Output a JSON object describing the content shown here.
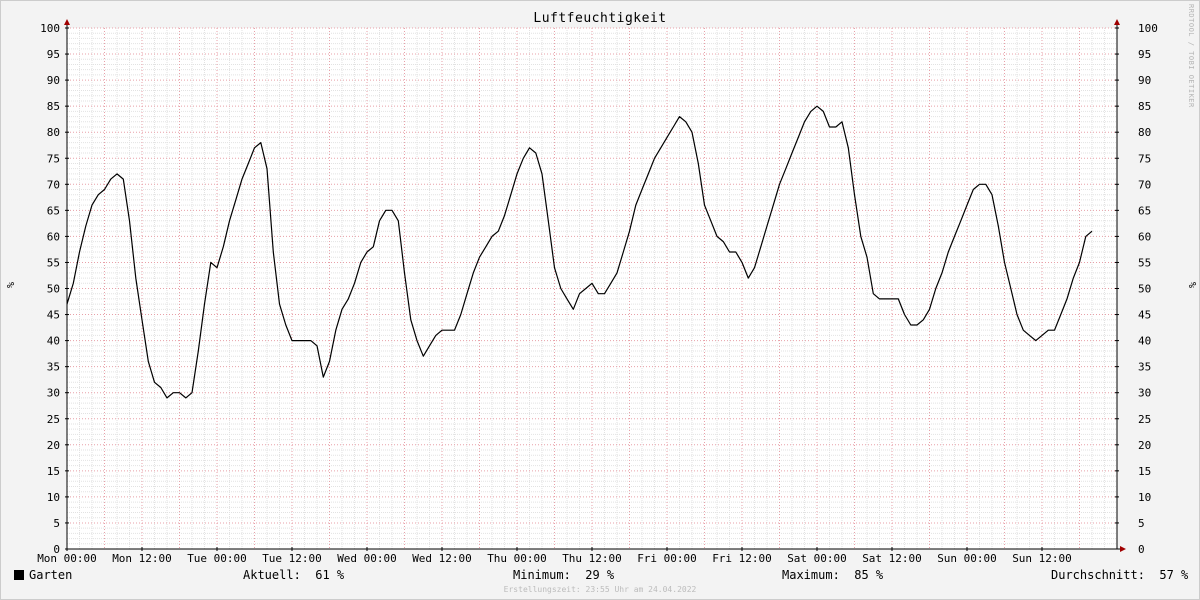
{
  "chart_data": {
    "type": "line",
    "title": "Luftfeuchtigkeit",
    "ylabel": "%",
    "ylim": [
      0,
      100
    ],
    "yticks": [
      0,
      5,
      10,
      15,
      20,
      25,
      30,
      35,
      40,
      45,
      50,
      55,
      60,
      65,
      70,
      75,
      80,
      85,
      90,
      95,
      100
    ],
    "x_tick_labels": [
      "Mon 00:00",
      "Mon 12:00",
      "Tue 00:00",
      "Tue 12:00",
      "Wed 00:00",
      "Wed 12:00",
      "Thu 00:00",
      "Thu 12:00",
      "Fri 00:00",
      "Fri 12:00",
      "Sat 00:00",
      "Sat 12:00",
      "Sun 00:00",
      "Sun 12:00"
    ],
    "x_unit": "hours since Mon 00:00",
    "xlim": [
      0,
      168
    ],
    "grid": true,
    "legend_position": "bottom-left",
    "series": [
      {
        "name": "Garten",
        "color": "#000000",
        "points": [
          [
            0,
            47
          ],
          [
            1,
            51
          ],
          [
            2,
            57
          ],
          [
            3,
            62
          ],
          [
            4,
            66
          ],
          [
            5,
            68
          ],
          [
            6,
            69
          ],
          [
            7,
            71
          ],
          [
            8,
            72
          ],
          [
            9,
            71
          ],
          [
            10,
            63
          ],
          [
            11,
            52
          ],
          [
            12,
            44
          ],
          [
            13,
            36
          ],
          [
            14,
            32
          ],
          [
            15,
            31
          ],
          [
            16,
            29
          ],
          [
            17,
            30
          ],
          [
            18,
            30
          ],
          [
            19,
            29
          ],
          [
            20,
            30
          ],
          [
            21,
            38
          ],
          [
            22,
            47
          ],
          [
            23,
            55
          ],
          [
            24,
            54
          ],
          [
            25,
            58
          ],
          [
            26,
            63
          ],
          [
            27,
            67
          ],
          [
            28,
            71
          ],
          [
            29,
            74
          ],
          [
            30,
            77
          ],
          [
            31,
            78
          ],
          [
            32,
            73
          ],
          [
            33,
            57
          ],
          [
            34,
            47
          ],
          [
            35,
            43
          ],
          [
            36,
            40
          ],
          [
            37,
            40
          ],
          [
            38,
            40
          ],
          [
            39,
            40
          ],
          [
            40,
            39
          ],
          [
            41,
            33
          ],
          [
            42,
            36
          ],
          [
            43,
            42
          ],
          [
            44,
            46
          ],
          [
            45,
            48
          ],
          [
            46,
            51
          ],
          [
            47,
            55
          ],
          [
            48,
            57
          ],
          [
            49,
            58
          ],
          [
            50,
            63
          ],
          [
            51,
            65
          ],
          [
            52,
            65
          ],
          [
            53,
            63
          ],
          [
            54,
            53
          ],
          [
            55,
            44
          ],
          [
            56,
            40
          ],
          [
            57,
            37
          ],
          [
            58,
            39
          ],
          [
            59,
            41
          ],
          [
            60,
            42
          ],
          [
            61,
            42
          ],
          [
            62,
            42
          ],
          [
            63,
            45
          ],
          [
            64,
            49
          ],
          [
            65,
            53
          ],
          [
            66,
            56
          ],
          [
            67,
            58
          ],
          [
            68,
            60
          ],
          [
            69,
            61
          ],
          [
            70,
            64
          ],
          [
            71,
            68
          ],
          [
            72,
            72
          ],
          [
            73,
            75
          ],
          [
            74,
            77
          ],
          [
            75,
            76
          ],
          [
            76,
            72
          ],
          [
            77,
            63
          ],
          [
            78,
            54
          ],
          [
            79,
            50
          ],
          [
            80,
            48
          ],
          [
            81,
            46
          ],
          [
            82,
            49
          ],
          [
            83,
            50
          ],
          [
            84,
            51
          ],
          [
            85,
            49
          ],
          [
            86,
            49
          ],
          [
            87,
            51
          ],
          [
            88,
            53
          ],
          [
            89,
            57
          ],
          [
            90,
            61
          ],
          [
            91,
            66
          ],
          [
            92,
            69
          ],
          [
            93,
            72
          ],
          [
            94,
            75
          ],
          [
            95,
            77
          ],
          [
            96,
            79
          ],
          [
            97,
            81
          ],
          [
            98,
            83
          ],
          [
            99,
            82
          ],
          [
            100,
            80
          ],
          [
            101,
            74
          ],
          [
            102,
            66
          ],
          [
            103,
            63
          ],
          [
            104,
            60
          ],
          [
            105,
            59
          ],
          [
            106,
            57
          ],
          [
            107,
            57
          ],
          [
            108,
            55
          ],
          [
            109,
            52
          ],
          [
            110,
            54
          ],
          [
            111,
            58
          ],
          [
            112,
            62
          ],
          [
            113,
            66
          ],
          [
            114,
            70
          ],
          [
            115,
            73
          ],
          [
            116,
            76
          ],
          [
            117,
            79
          ],
          [
            118,
            82
          ],
          [
            119,
            84
          ],
          [
            120,
            85
          ],
          [
            121,
            84
          ],
          [
            122,
            81
          ],
          [
            123,
            81
          ],
          [
            124,
            82
          ],
          [
            125,
            77
          ],
          [
            126,
            68
          ],
          [
            127,
            60
          ],
          [
            128,
            56
          ],
          [
            129,
            49
          ],
          [
            130,
            48
          ],
          [
            131,
            48
          ],
          [
            132,
            48
          ],
          [
            133,
            48
          ],
          [
            134,
            45
          ],
          [
            135,
            43
          ],
          [
            136,
            43
          ],
          [
            137,
            44
          ],
          [
            138,
            46
          ],
          [
            139,
            50
          ],
          [
            140,
            53
          ],
          [
            141,
            57
          ],
          [
            142,
            60
          ],
          [
            143,
            63
          ],
          [
            144,
            66
          ],
          [
            145,
            69
          ],
          [
            146,
            70
          ],
          [
            147,
            70
          ],
          [
            148,
            68
          ],
          [
            149,
            62
          ],
          [
            150,
            55
          ],
          [
            151,
            50
          ],
          [
            152,
            45
          ],
          [
            153,
            42
          ],
          [
            154,
            41
          ],
          [
            155,
            40
          ],
          [
            156,
            41
          ],
          [
            157,
            42
          ],
          [
            158,
            42
          ],
          [
            159,
            45
          ],
          [
            160,
            48
          ],
          [
            161,
            52
          ],
          [
            162,
            55
          ],
          [
            163,
            60
          ],
          [
            164,
            61
          ]
        ]
      }
    ]
  },
  "watermark": "RRDTOOL / TOBI OETIKER",
  "legend": {
    "series_name": "Garten",
    "current_label": "Aktuell:",
    "current_value": "61 %",
    "min_label": "Minimum:",
    "min_value": "29 %",
    "max_label": "Maximum:",
    "max_value": "85 %",
    "avg_label": "Durchschnitt:",
    "avg_value": "57 %"
  },
  "footer": "Erstellungszeit: 23:55 Uhr am 24.04.2022"
}
